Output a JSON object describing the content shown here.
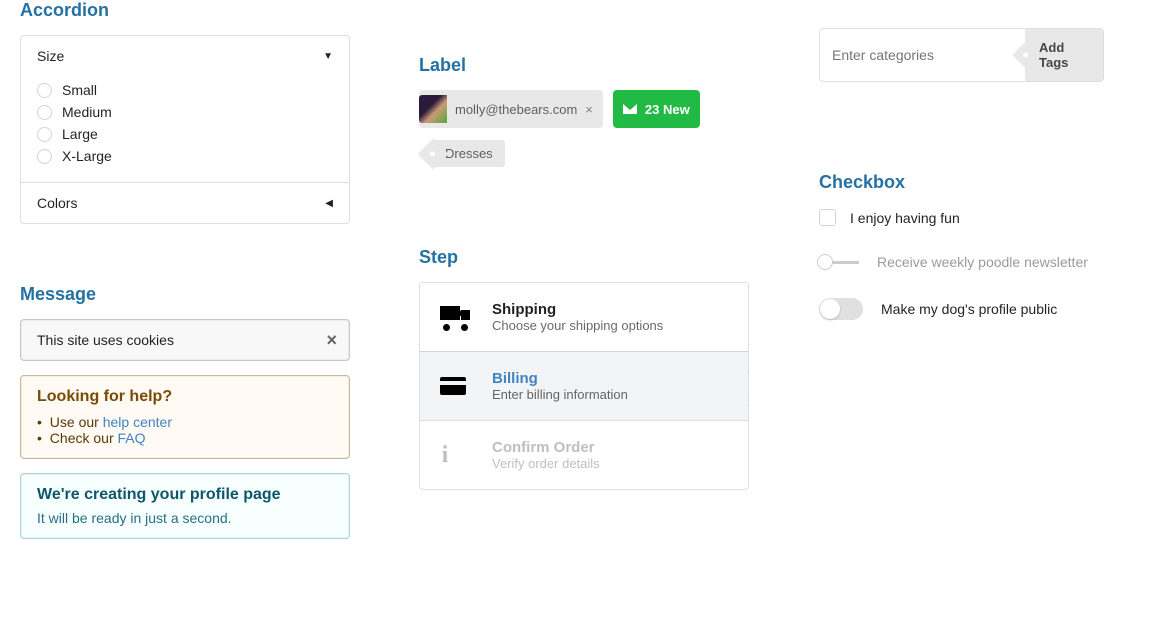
{
  "accordion": {
    "heading": "Accordion",
    "size_title": "Size",
    "colors_title": "Colors",
    "options": [
      "Small",
      "Medium",
      "Large",
      "X-Large"
    ]
  },
  "message": {
    "heading": "Message",
    "cookie": "This site uses cookies",
    "warning_hdr": "Looking for help?",
    "warning_line1a": "Use our ",
    "warning_link1": "help center",
    "warning_line2a": "Check our ",
    "warning_link2": "FAQ",
    "info_hdr": "We're creating your profile page",
    "info_body": "It will be ready in just a second."
  },
  "label": {
    "heading": "Label",
    "email": "molly@thebears.com",
    "badge": "23 New",
    "tag": "Dresses"
  },
  "step": {
    "heading": "Step",
    "items": [
      {
        "title": "Shipping",
        "desc": "Choose your shipping options"
      },
      {
        "title": "Billing",
        "desc": "Enter billing information"
      },
      {
        "title": "Confirm Order",
        "desc": "Verify order details"
      }
    ]
  },
  "tags_input": {
    "placeholder": "Enter categories",
    "button": "Add Tags"
  },
  "checkbox": {
    "heading": "Checkbox",
    "cb1": "I enjoy having fun",
    "cb2": "Receive weekly poodle newsletter",
    "cb3": "Make my dog's profile public"
  }
}
